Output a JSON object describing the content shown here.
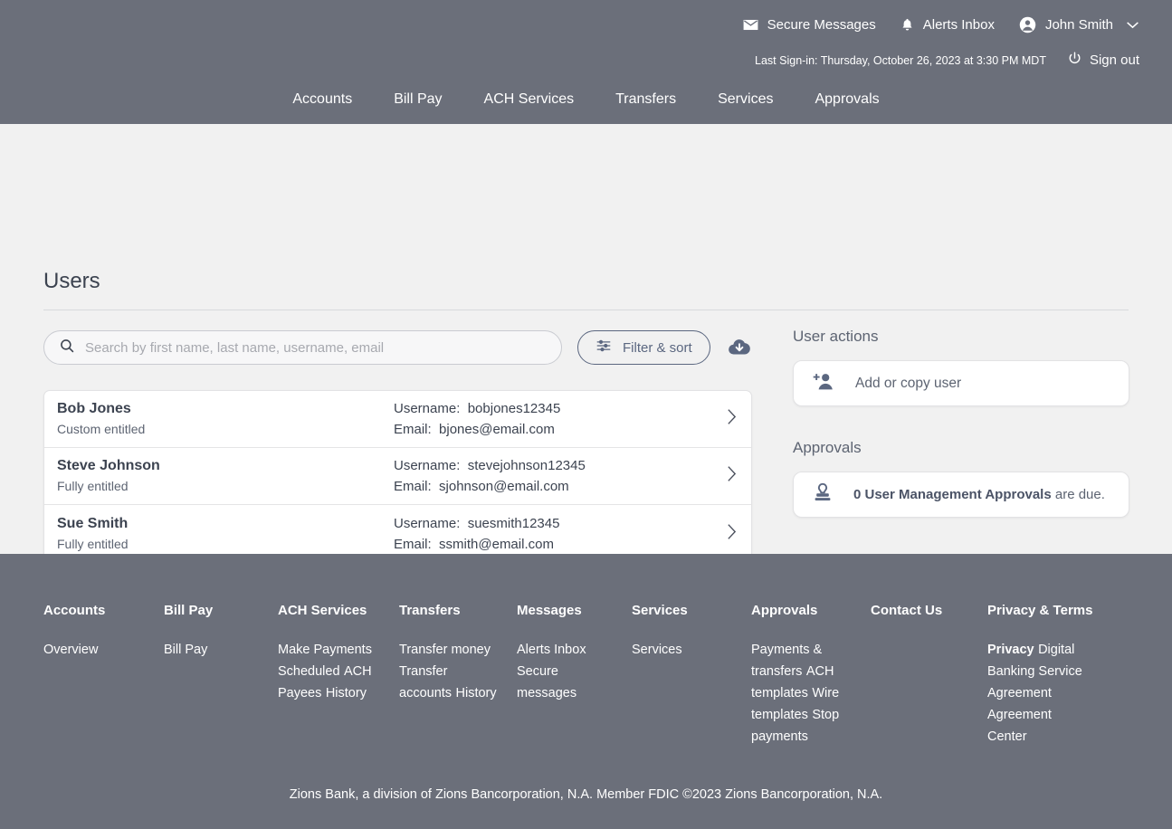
{
  "header": {
    "utility": [
      {
        "icon": "envelope-icon",
        "label": "Secure Messages"
      },
      {
        "icon": "bell-icon",
        "label": "Alerts Inbox"
      },
      {
        "icon": "user-avatar-icon",
        "label": "John Smith",
        "caret": "chevron-down-icon"
      }
    ],
    "last_signin": "Last Sign-in: Thursday, October 26, 2023 at 3:30 PM MDT",
    "sign_out": "Sign out",
    "nav": [
      "Accounts",
      "Bill Pay",
      "ACH Services",
      "Transfers",
      "Services",
      "Approvals"
    ],
    "bg_color": "#6b6f7a"
  },
  "main": {
    "title": "Users",
    "search": {
      "placeholder": "Search by first name, last name, username, email",
      "value": ""
    },
    "filter_label": "Filter & sort",
    "download_icon": "cloud-download-icon",
    "labels": {
      "username": "Username:",
      "email": "Email:"
    },
    "users": [
      {
        "name": "Bob Jones",
        "entitlement": "Custom entitled",
        "username": "bobjones12345",
        "email": "bjones@email.com"
      },
      {
        "name": "Steve Johnson",
        "entitlement": "Fully entitled",
        "username": "stevejohnson12345",
        "email": "sjohnson@email.com"
      },
      {
        "name": "Sue Smith",
        "entitlement": "Fully entitled",
        "username": "suesmith12345",
        "email": "ssmith@email.com"
      }
    ]
  },
  "side": {
    "user_actions_heading": "User actions",
    "add_copy_user": "Add or copy user",
    "approvals_heading": "Approvals",
    "approvals_count_text": "0 User Management Approvals",
    "approvals_suffix": " are due."
  },
  "footer": {
    "columns": [
      {
        "head": "Accounts",
        "links": [
          "Overview"
        ]
      },
      {
        "head": "Bill Pay",
        "links": [
          "Bill Pay"
        ]
      },
      {
        "head": "ACH Services",
        "links": [
          "Make Payments",
          "Scheduled",
          "ACH Payees",
          "History"
        ]
      },
      {
        "head": "Transfers",
        "links": [
          "Transfer money",
          "Transfer accounts",
          "History"
        ]
      },
      {
        "head": "Messages",
        "links": [
          "Alerts Inbox",
          "Secure messages"
        ]
      },
      {
        "head": "Services",
        "links": [
          "Services"
        ]
      },
      {
        "head": "Approvals",
        "links": [
          "Payments & transfers",
          "ACH templates",
          "Wire templates",
          "Stop payments"
        ]
      },
      {
        "head": "Contact Us",
        "links": []
      },
      {
        "head": "Privacy & Terms",
        "links": [
          "Privacy",
          "Digital Banking Service Agreement",
          "Agreement Center"
        ]
      }
    ],
    "legal": "Zions Bank, a division of Zions Bancorporation, N.A. Member FDIC ©2023 Zions Bancorporation, N.A."
  }
}
